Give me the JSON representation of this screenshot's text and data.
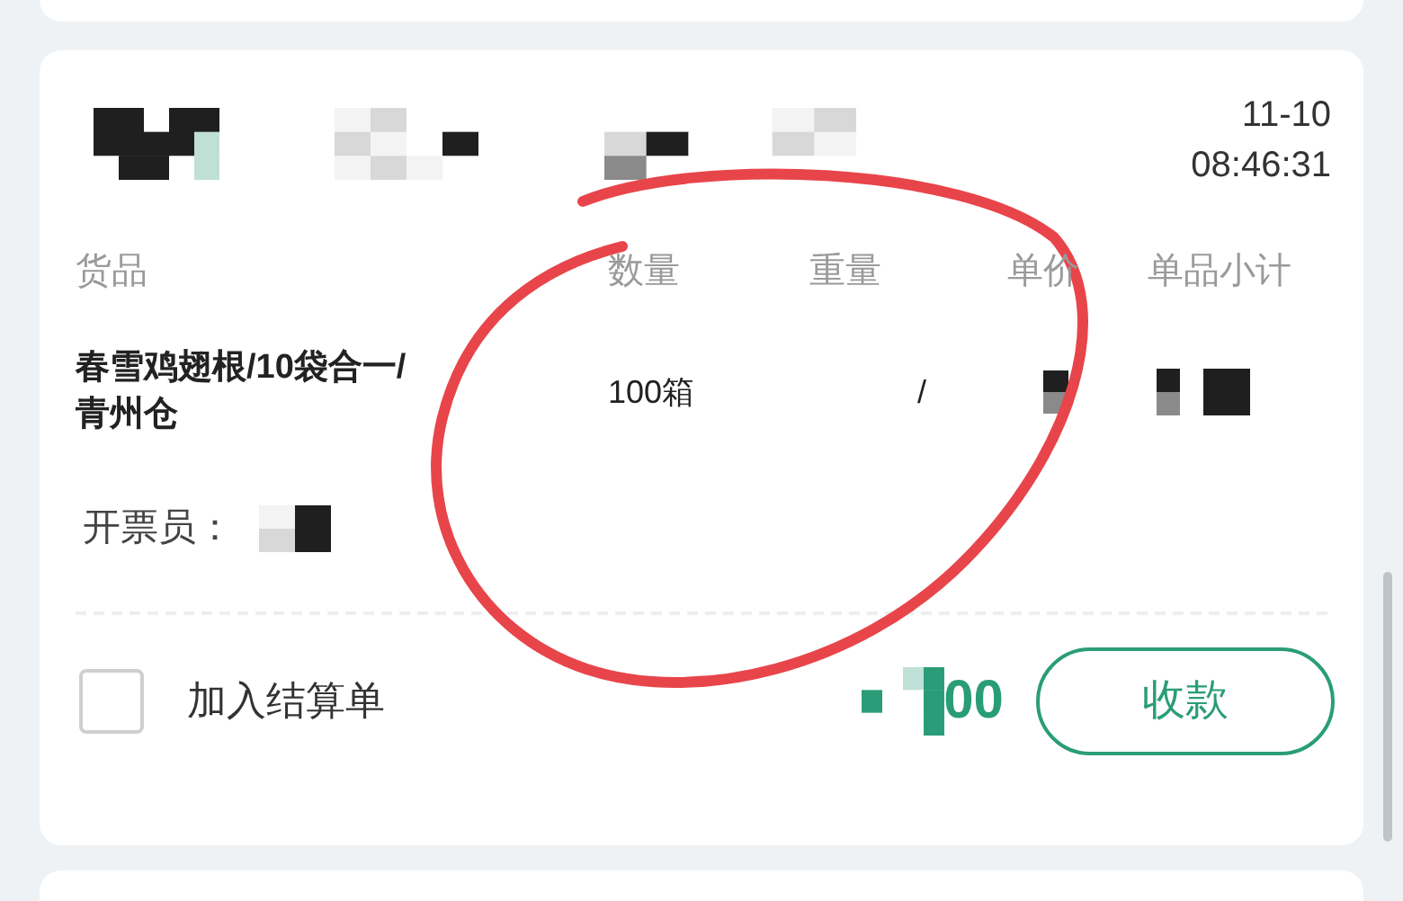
{
  "header": {
    "date": "11-10",
    "time": "08:46:31"
  },
  "columns": [
    "货品",
    "数量",
    "重量",
    "单价",
    "单品小计"
  ],
  "item": {
    "name": "春雪鸡翅根/10袋合一/青州仓",
    "quantity": "100箱",
    "weight": "/"
  },
  "issuer_label": "开票员：",
  "settle": {
    "label": "加入结算单",
    "checked": false
  },
  "amount": "00",
  "collect_button": "收款"
}
